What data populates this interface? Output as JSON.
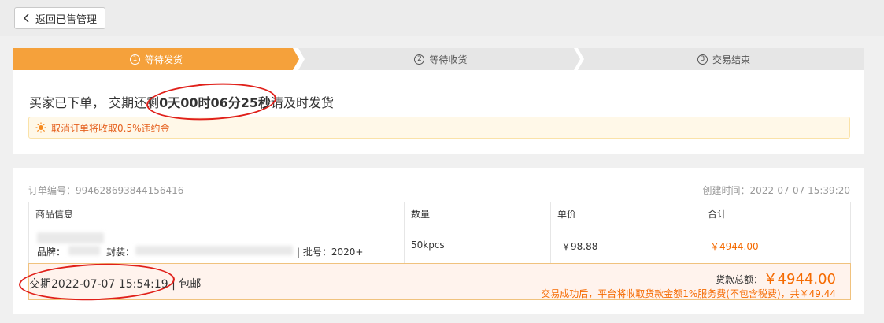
{
  "header": {
    "back_label": "返回已售管理"
  },
  "steps": [
    {
      "num": "1",
      "label": "等待发货",
      "active": true
    },
    {
      "num": "2",
      "label": "等待收货",
      "active": false
    },
    {
      "num": "3",
      "label": "交易结束",
      "active": false
    }
  ],
  "status": {
    "prefix": "买家已下单，  交期还剩",
    "countdown": "0天00时06分25秒",
    "suffix": "请及时发货"
  },
  "notice": {
    "text": "取消订单将收取0.5%违约金"
  },
  "order": {
    "number_label": "订单编号：",
    "number": "994628693844156416",
    "created_label": "创建时间：",
    "created": "2022-07-07 15:39:20"
  },
  "table": {
    "headers": {
      "product": "商品信息",
      "qty": "数量",
      "price": "单价",
      "subtotal": "合计"
    },
    "row": {
      "brand_label": "品牌：",
      "package_label": "封装：",
      "batch_label": "批号：",
      "batch": "2020+",
      "qty": "50kpcs",
      "price": "￥98.88",
      "subtotal": "￥4944.00"
    }
  },
  "summary": {
    "deadline_label": "交期",
    "deadline": "2022-07-07 15:54:19",
    "shipping": "包邮",
    "total_label": "货款总额：",
    "total": "￥4944.00",
    "fee_note": "交易成功后，平台将收取货款金额1%服务费(不包含税费)，共￥49.44"
  },
  "colors": {
    "accent": "#f5a13b",
    "price": "#f56a00",
    "annotation": "#e0201a"
  }
}
